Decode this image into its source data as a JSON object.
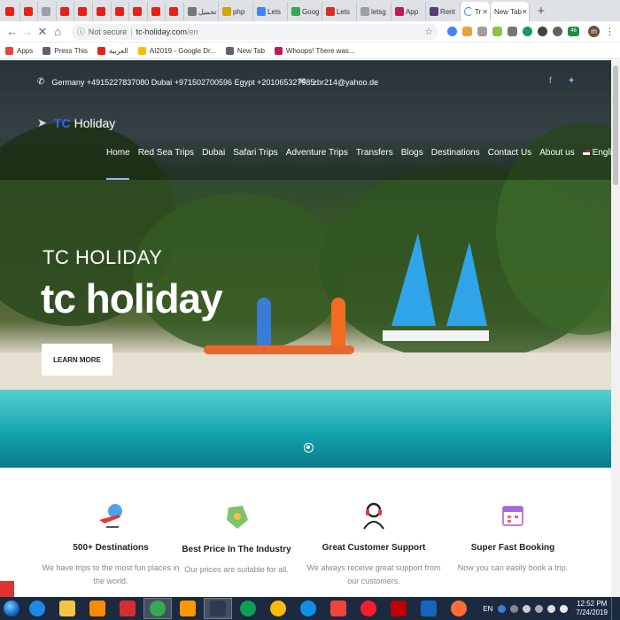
{
  "browser": {
    "tabs": [
      {
        "label": "",
        "color": "#e62117"
      },
      {
        "label": "",
        "color": "#e62117"
      },
      {
        "label": "",
        "color": "#9aa0a6"
      },
      {
        "label": "",
        "color": "#e62117"
      },
      {
        "label": "",
        "color": "#e62117"
      },
      {
        "label": "",
        "color": "#e62117"
      },
      {
        "label": "",
        "color": "#e62117"
      },
      {
        "label": "",
        "color": "#e62117"
      },
      {
        "label": "",
        "color": "#e62117"
      },
      {
        "label": "",
        "color": "#e62117"
      },
      {
        "label": "تحميل",
        "color": "#777777",
        "wide": true
      },
      {
        "label": "php",
        "color": "#d9a400",
        "wide": true
      },
      {
        "label": "Lets",
        "color": "#4285f4",
        "wide": true
      },
      {
        "label": "Goog",
        "color": "#34a853",
        "wide": true
      },
      {
        "label": "Lets",
        "color": "#d93025",
        "wide": true
      },
      {
        "label": "letsg",
        "color": "#9aa0a6",
        "wide": true
      },
      {
        "label": "App",
        "color": "#c2185b",
        "wide": true
      },
      {
        "label": "Rent",
        "color": "#563d7c",
        "wide": true
      }
    ],
    "active_tab_label": "Tr",
    "new_tab_label": "New Tab",
    "new_tab_button": "+",
    "address": {
      "security_label": "Not secure",
      "separator": "|",
      "domain": "tc-holiday.com",
      "path": "/en"
    },
    "bookmarks": [
      {
        "label": "Apps",
        "color": "#ea4335"
      },
      {
        "label": "Press This",
        "color": "#5f6368"
      },
      {
        "label": "العربية",
        "color": "#e62117"
      },
      {
        "label": "AI2019 - Google Dr...",
        "color": "#fbbc04"
      },
      {
        "label": "New Tab",
        "color": "#5f6368"
      },
      {
        "label": "Whoops! There was...",
        "color": "#c2185b"
      }
    ],
    "avatar_letter": "m",
    "extension_badge": "46"
  },
  "site": {
    "contact": {
      "phones": "Germany +4915227837080 Dubai +971502700596 Egypt +201065327985",
      "email": "zbr214@yahoo.de"
    },
    "brand": {
      "prefix": "TC",
      "name": "Holiday"
    },
    "nav": [
      "Home",
      "Red Sea Trips",
      "Dubai",
      "Safari Trips",
      "Adventure Trips",
      "Transfers",
      "Blogs",
      "Destinations",
      "Contact Us",
      "About us"
    ],
    "language": "English",
    "hero": {
      "subtitle": "TC HOLIDAY",
      "title": "tc holiday",
      "button": "LEARN MORE"
    },
    "features": [
      {
        "title": "500+ Destinations",
        "desc": "We have trips to the most fun places in the world.",
        "icon": "plane-globe-icon"
      },
      {
        "title": "Best Price In The Industry",
        "desc": "Our prices are suitable for all.",
        "icon": "price-tag-icon"
      },
      {
        "title": "Great Customer Support",
        "desc": "We always receive great support from our customers.",
        "icon": "headset-icon"
      },
      {
        "title": "Super Fast Booking",
        "desc": "Now you can easily book a trip.",
        "icon": "calendar-icon"
      }
    ]
  },
  "taskbar": {
    "apps": [
      {
        "name": "ie-icon",
        "color": "#1e88e5",
        "round": true
      },
      {
        "name": "explorer-icon",
        "color": "#f4c542"
      },
      {
        "name": "media-player-icon",
        "color": "#ff8a00"
      },
      {
        "name": "zynga-icon",
        "color": "#d32f2f"
      },
      {
        "name": "chrome-icon",
        "color": "#34a853",
        "round": true,
        "active": true
      },
      {
        "name": "sublime-icon",
        "color": "#ff9800"
      },
      {
        "name": "terminal-icon",
        "color": "#2e3b4e",
        "active": true
      },
      {
        "name": "hangouts-icon",
        "color": "#0f9d58",
        "round": true
      },
      {
        "name": "chrome-dev-icon",
        "color": "#fbbc04",
        "round": true
      },
      {
        "name": "teamviewer-icon",
        "color": "#0e8ee9",
        "round": true
      },
      {
        "name": "anydesk-icon",
        "color": "#ef443b"
      },
      {
        "name": "opera-icon",
        "color": "#ff1b2d",
        "round": true
      },
      {
        "name": "filezilla-icon",
        "color": "#bf0000"
      },
      {
        "name": "app-icon",
        "color": "#1565c0"
      },
      {
        "name": "postman-icon",
        "color": "#ff6c37",
        "round": true
      }
    ],
    "language": "EN",
    "time": "12:52 PM",
    "date": "7/24/2019"
  }
}
